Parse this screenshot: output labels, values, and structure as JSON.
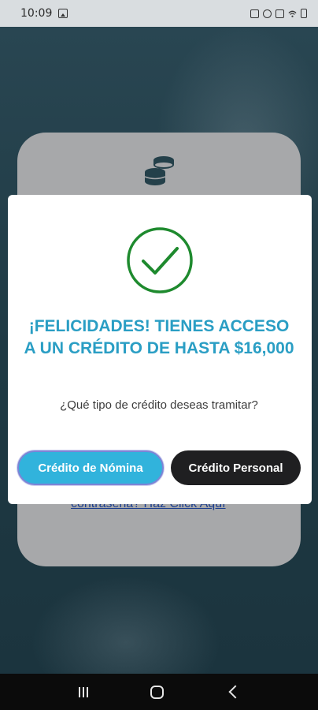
{
  "status_bar": {
    "time": "10:09",
    "icons": [
      "gallery-icon",
      "notification-icon",
      "alarm-icon",
      "mute-icon",
      "wifi-icon",
      "battery-icon"
    ]
  },
  "login_card": {
    "link_text": "contraseña? Haz Click Aquí",
    "icon": "coins-icon"
  },
  "modal": {
    "icon": "check-circle-icon",
    "title": "¡FELICIDADES! TIENES ACCESO A UN CRÉDITO DE HASTA $16,000",
    "question": "¿Qué tipo de crédito deseas tramitar?",
    "buttons": {
      "nomina": "Crédito de Nómina",
      "personal": "Crédito Personal"
    }
  },
  "colors": {
    "accent": "#2a9ec4",
    "primary_button": "#31b3dc",
    "secondary_button": "#1f1f21",
    "check_green": "#1e8a2e"
  },
  "nav_bar": {
    "icons": [
      "recents-icon",
      "home-icon",
      "back-icon"
    ]
  }
}
